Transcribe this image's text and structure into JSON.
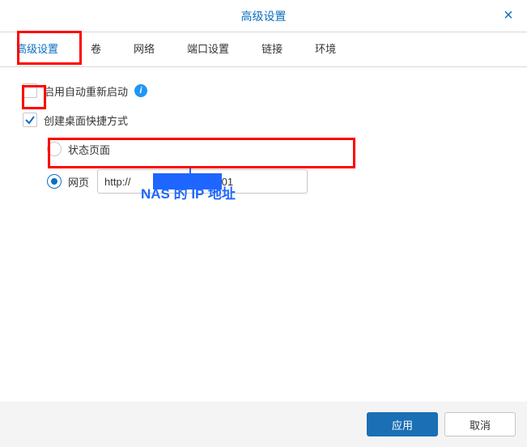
{
  "colors": {
    "accent": "#0a6fc2",
    "highlight": "#ff0000",
    "callout": "#1e66ff"
  },
  "titlebar": {
    "title": "高级设置"
  },
  "tabs": {
    "items": [
      {
        "label": "高级设置",
        "active": true
      },
      {
        "label": "卷"
      },
      {
        "label": "网络"
      },
      {
        "label": "端口设置"
      },
      {
        "label": "链接"
      },
      {
        "label": "环境"
      }
    ]
  },
  "options": {
    "auto_restart": {
      "label": "启用自动重新启动",
      "checked": false
    },
    "desktop_shortcut": {
      "label": "创建桌面快捷方式",
      "checked": true
    },
    "shortcut_targets": {
      "status_page": {
        "label": "状态页面",
        "selected": false
      },
      "web_page": {
        "label": "网页",
        "selected": true,
        "value_prefix": "http://",
        "value_suffix": ":3001"
      }
    }
  },
  "callout": {
    "label": "NAS 的 IP 地址"
  },
  "footer": {
    "apply": "应用",
    "cancel": "取消"
  }
}
